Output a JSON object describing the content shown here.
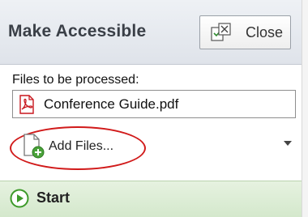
{
  "header": {
    "title": "Make Accessible",
    "close_label": "Close"
  },
  "files": {
    "label": "Files to be processed:",
    "items": [
      "Conference Guide.pdf"
    ]
  },
  "actions": {
    "add_files_label": "Add Files..."
  },
  "start": {
    "label": "Start"
  },
  "icons": {
    "close": "close-panel-icon",
    "pdf": "pdf-file-icon",
    "add_files": "add-document-icon",
    "start": "play-icon"
  },
  "colors": {
    "highlight_ring": "#d11a1a",
    "pdf_red": "#c8161d",
    "start_green": "#3d9a2a",
    "start_bar": "#dcecd4"
  }
}
